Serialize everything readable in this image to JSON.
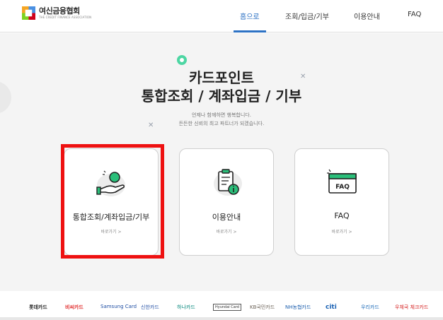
{
  "header": {
    "logo_title": "여신금융협회",
    "logo_subtitle": "THE CREDIT FINANCE ASSOCIATION",
    "nav": [
      {
        "label": "홈으로",
        "active": true
      },
      {
        "label": "조회/입금/기부",
        "active": false
      },
      {
        "label": "이용안내",
        "active": false
      },
      {
        "label": "FAQ",
        "active": false
      }
    ]
  },
  "hero": {
    "title_line1": "카드포인트",
    "title_line2": "통합조회 / 계좌입금 / 기부",
    "desc_line1": "언제나 함께하면 행복합니다.",
    "desc_line2": "든든한 신뢰의 최고 파트너가 되겠습니다."
  },
  "cards": [
    {
      "label": "통합조회/계좌입금/기부",
      "link": "바로가기 >",
      "icon": "hand-coin-icon"
    },
    {
      "label": "이용안내",
      "link": "바로가기 >",
      "icon": "clipboard-info-icon"
    },
    {
      "label": "FAQ",
      "link": "바로가기 >",
      "icon": "faq-window-icon"
    }
  ],
  "partners": [
    {
      "name": "롯데카드",
      "color": "#222222"
    },
    {
      "name": "비씨카드",
      "color": "#e12d2d"
    },
    {
      "name": "Samsung Card",
      "color": "#1f4ea3"
    },
    {
      "name": "신한카드",
      "color": "#2a55a8"
    },
    {
      "name": "하나카드",
      "color": "#00857a"
    },
    {
      "name": "Hyundai Card",
      "color": "#333333"
    },
    {
      "name": "KB국민카드",
      "color": "#6b6257"
    },
    {
      "name": "NH농협카드",
      "color": "#1d5fae"
    },
    {
      "name": "citi",
      "color": "#1b62b4"
    },
    {
      "name": "우리카드",
      "color": "#1b6ab8"
    },
    {
      "name": "우체국 체크카드",
      "color": "#d52222"
    }
  ],
  "colors": {
    "accent": "#2d72c4",
    "highlight": "#ee1111",
    "mint": "#4dd6a3"
  }
}
